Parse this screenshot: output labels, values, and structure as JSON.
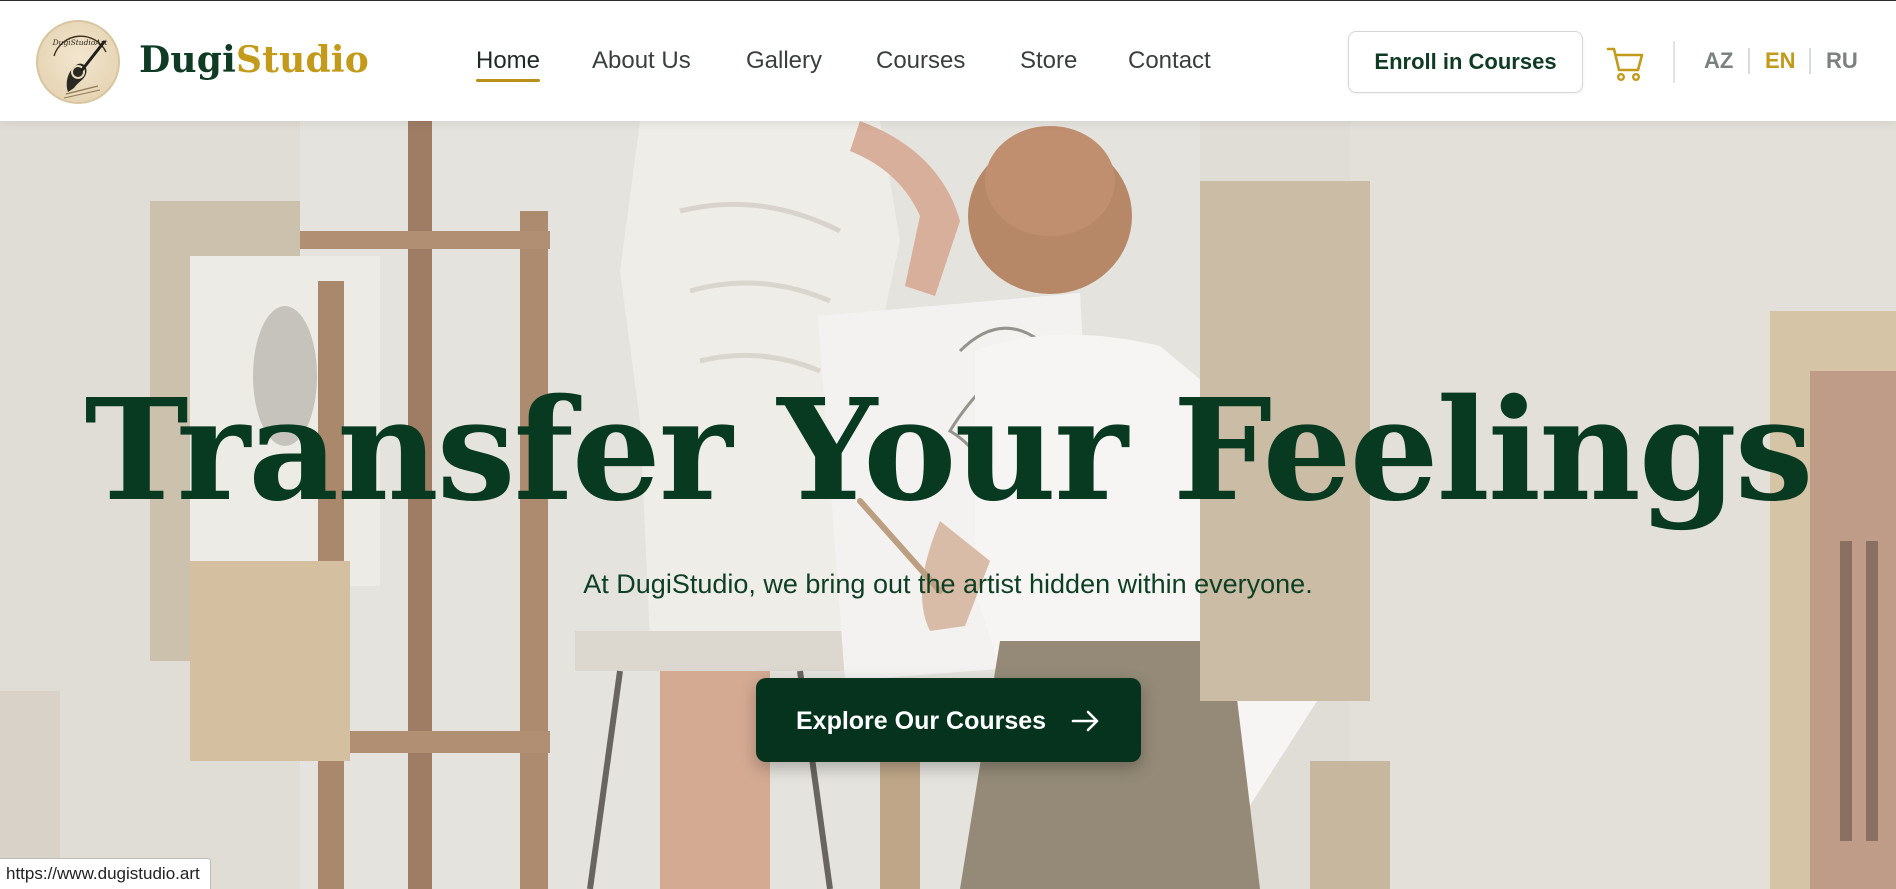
{
  "brand": {
    "name_part1": "Dugi",
    "name_part2": "Studio",
    "logo_icon": "brush-hand-logo-icon",
    "colors": {
      "dark_green": "#0f3a24",
      "gold": "#c39a1a"
    }
  },
  "nav": {
    "items": [
      {
        "label": "Home",
        "active": true
      },
      {
        "label": "About Us",
        "active": false
      },
      {
        "label": "Gallery",
        "active": false
      },
      {
        "label": "Courses",
        "active": false
      },
      {
        "label": "Store",
        "active": false
      },
      {
        "label": "Contact",
        "active": false
      }
    ]
  },
  "header": {
    "enroll_label": "Enroll in Courses",
    "cart_icon": "shopping-cart-icon",
    "languages": [
      {
        "code": "AZ",
        "active": false
      },
      {
        "code": "EN",
        "active": true
      },
      {
        "code": "RU",
        "active": false
      }
    ]
  },
  "hero": {
    "title": "Transfer Your Feelings",
    "subtitle": "At DugiStudio, we bring out the artist hidden within everyone.",
    "cta_label": "Explore Our Courses",
    "cta_icon": "arrow-right-icon",
    "background": "art-studio-painter-photo",
    "colors": {
      "title": "#073a20",
      "button": "#05331d"
    }
  },
  "status_bar": {
    "url": "https://www.dugistudio.art"
  }
}
